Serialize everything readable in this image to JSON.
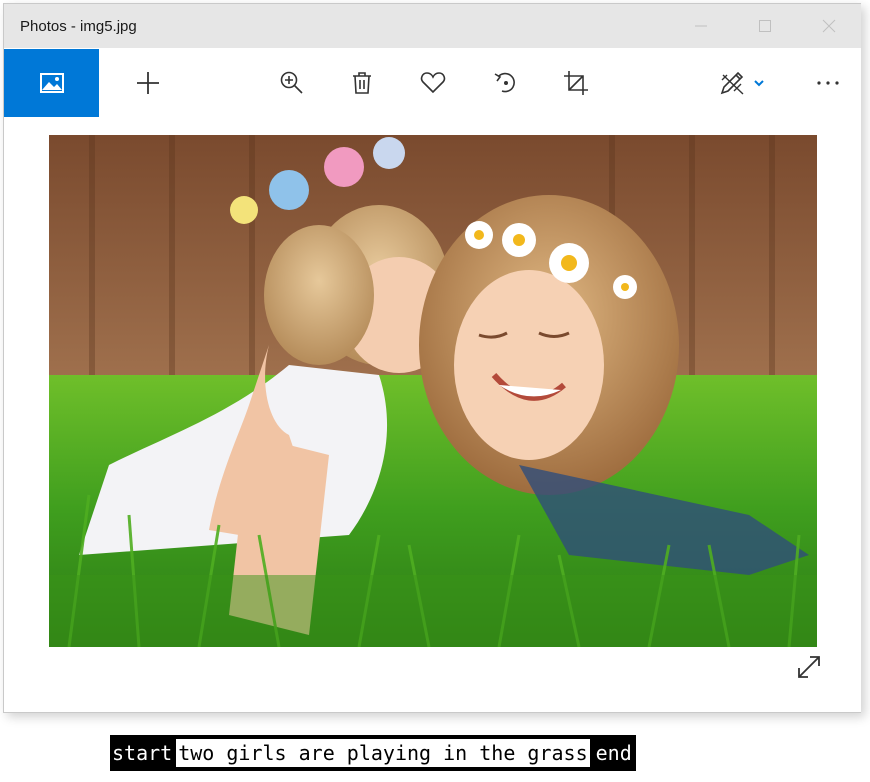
{
  "window": {
    "title": "Photos - img5.jpg"
  },
  "controls": {
    "minimize": "minimize-icon",
    "maximize": "maximize-icon",
    "close": "close-icon"
  },
  "toolbar": {
    "items": [
      {
        "name": "view-photo",
        "icon": "image-icon",
        "active": true
      },
      {
        "name": "add",
        "icon": "plus-icon"
      },
      {
        "name": "zoom",
        "icon": "zoom-in-icon"
      },
      {
        "name": "delete",
        "icon": "trash-icon"
      },
      {
        "name": "favorite",
        "icon": "heart-icon"
      },
      {
        "name": "rotate",
        "icon": "rotate-icon"
      },
      {
        "name": "crop",
        "icon": "crop-icon"
      },
      {
        "name": "edit-create",
        "icon": "pen-draw-icon"
      },
      {
        "name": "more",
        "icon": "more-icon"
      }
    ],
    "accent": "#0078d7"
  },
  "caption": {
    "start": "start",
    "text": "two girls are playing in the grass",
    "end": "end"
  }
}
